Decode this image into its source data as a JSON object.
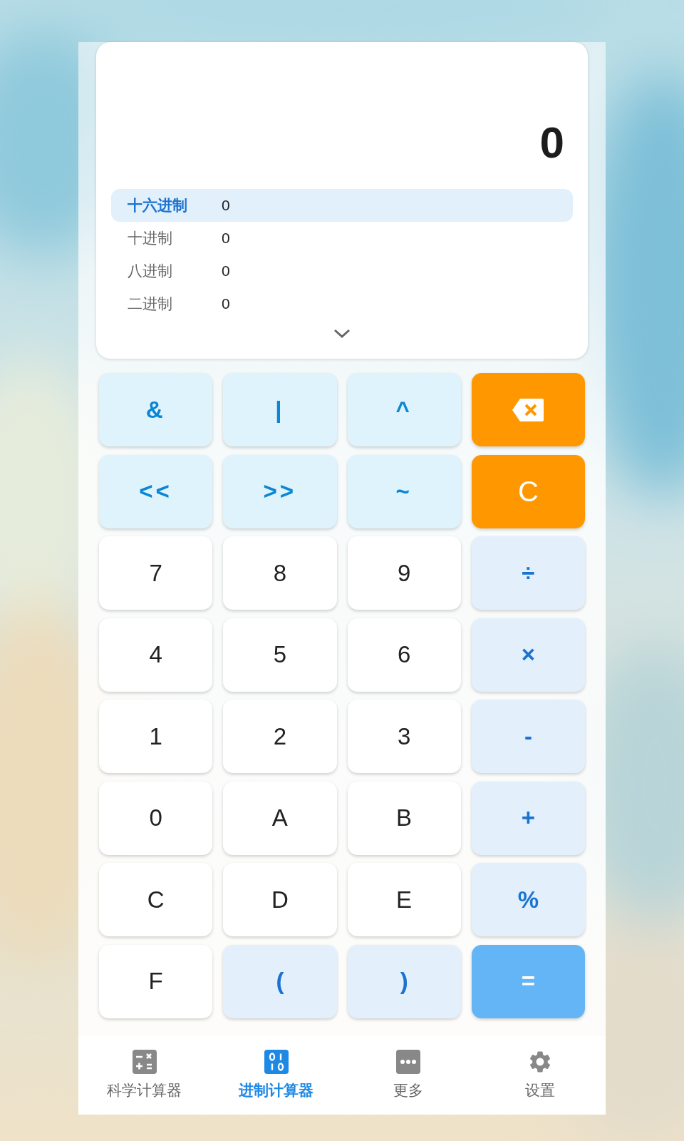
{
  "display": {
    "result": "0",
    "bases": [
      {
        "label": "十六进制",
        "value": "0",
        "selected": true
      },
      {
        "label": "十进制",
        "value": "0",
        "selected": false
      },
      {
        "label": "八进制",
        "value": "0",
        "selected": false
      },
      {
        "label": "二进制",
        "value": "0",
        "selected": false
      }
    ]
  },
  "keys": [
    {
      "label": "&",
      "kind": "bit"
    },
    {
      "label": "|",
      "kind": "bit"
    },
    {
      "label": "^",
      "kind": "bit"
    },
    {
      "kind": "backspace"
    },
    {
      "label": "<<",
      "kind": "bit"
    },
    {
      "label": ">>",
      "kind": "bit"
    },
    {
      "label": "~",
      "kind": "bit"
    },
    {
      "label": "C",
      "kind": "clear"
    },
    {
      "label": "7",
      "kind": "digit"
    },
    {
      "label": "8",
      "kind": "digit"
    },
    {
      "label": "9",
      "kind": "digit"
    },
    {
      "label": "÷",
      "kind": "op"
    },
    {
      "label": "4",
      "kind": "digit"
    },
    {
      "label": "5",
      "kind": "digit"
    },
    {
      "label": "6",
      "kind": "digit"
    },
    {
      "label": "×",
      "kind": "op"
    },
    {
      "label": "1",
      "kind": "digit"
    },
    {
      "label": "2",
      "kind": "digit"
    },
    {
      "label": "3",
      "kind": "digit"
    },
    {
      "label": "-",
      "kind": "op"
    },
    {
      "label": "0",
      "kind": "digit"
    },
    {
      "label": "A",
      "kind": "digit"
    },
    {
      "label": "B",
      "kind": "digit"
    },
    {
      "label": "+",
      "kind": "op"
    },
    {
      "label": "C",
      "kind": "digit"
    },
    {
      "label": "D",
      "kind": "digit"
    },
    {
      "label": "E",
      "kind": "digit"
    },
    {
      "label": "%",
      "kind": "op"
    },
    {
      "label": "F",
      "kind": "digit"
    },
    {
      "label": "(",
      "kind": "op"
    },
    {
      "label": ")",
      "kind": "op"
    },
    {
      "label": "=",
      "kind": "equals"
    }
  ],
  "nav": [
    {
      "label": "科学计算器",
      "kind": "scientific",
      "selected": false
    },
    {
      "label": "进制计算器",
      "kind": "base",
      "selected": true
    },
    {
      "label": "更多",
      "kind": "more",
      "selected": false
    },
    {
      "label": "设置",
      "kind": "settings",
      "selected": false
    }
  ]
}
